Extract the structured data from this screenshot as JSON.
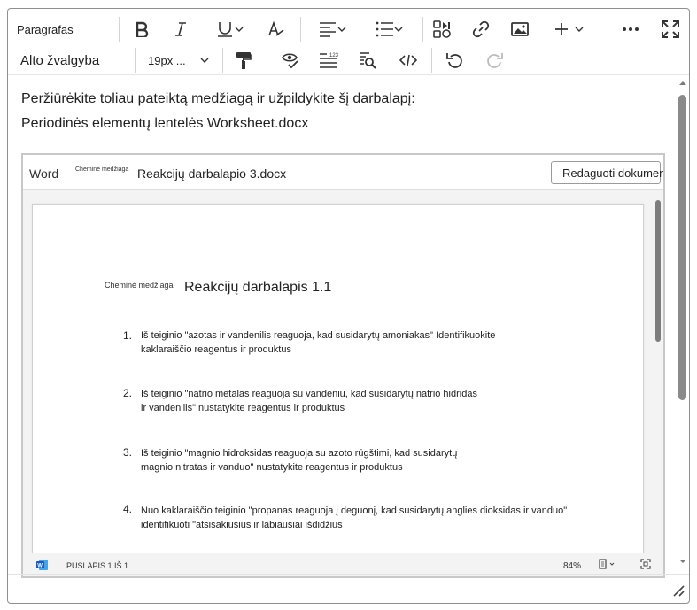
{
  "toolbar": {
    "paragraph_style": "Paragrafas",
    "alignment_label": "Alto žvalgyba",
    "font_size": "19px ...",
    "icons": [
      "bold-icon",
      "italic-icon",
      "underline-icon",
      "text-format-icon",
      "align-left-icon",
      "list-icon",
      "insert-media-icon",
      "link-icon",
      "image-icon",
      "plus-icon",
      "more-icon",
      "fullscreen-icon",
      "format-painter-icon",
      "spellcheck-icon",
      "line-spacing-icon",
      "find-replace-icon",
      "source-code-icon",
      "undo-icon",
      "redo-icon"
    ]
  },
  "content": {
    "line1": "Peržiūrėkite toliau pateiktą medžiagą ir užpildykite šį darbalapį:",
    "line2": "Periodinės elementų lentelės Worksheet.docx"
  },
  "embed": {
    "app_label": "Word",
    "prefix_small": "Cheminė medžiaga",
    "header_title": "Reakcijų darbalapio 3.docx",
    "edit_button": "Redaguoti dokumentą",
    "doc_prefix": "Cheminė medžiaga",
    "doc_title": "Reakcijų darbalapis 1.1",
    "items": [
      {
        "num": "1.",
        "line1": "Iš teiginio \"azotas ir vandenilis reaguoja, kad susidarytų amoniakas\" Identifikuokite",
        "line2": "kaklaraiščio reagentus ir produktus"
      },
      {
        "num": "2.",
        "line1": "Iš teiginio \"natrio metalas reaguoja su vandeniu, kad susidarytų natrio hidridas",
        "line2": "ir vandenilis\" nustatykite reagentus ir produktus"
      },
      {
        "num": "3.",
        "line1": "Iš teiginio \"magnio hidroksidas reaguoja su azoto rūgštimi, kad susidarytų",
        "line2": "magnio nitratas ir vanduo\" nustatykite reagentus ir produktus"
      },
      {
        "num": "4.",
        "line1": "Nuo kaklaraiščio teiginio \"propanas reaguoja į deguonį, kad susidarytų anglies dioksidas ir vanduo\"",
        "line2": "identifikuoti \"atsisakiusius ir labiausiai išdidžius"
      }
    ],
    "status_page": "PUSLAPIS 1 IŠ 1",
    "zoom": "84%"
  },
  "colors": {
    "word_blue": "#185abd",
    "border": "#8f8f8f"
  }
}
